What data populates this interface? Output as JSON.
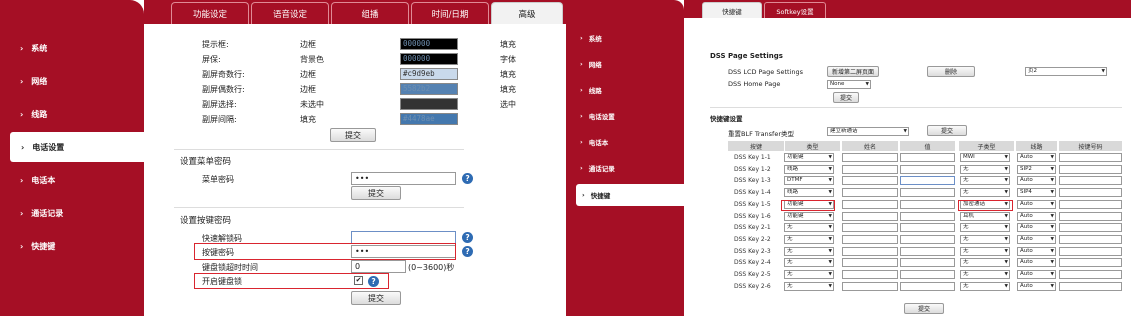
{
  "left": {
    "nav": [
      {
        "label": "系统",
        "active": false
      },
      {
        "label": "网络",
        "active": false
      },
      {
        "label": "线路",
        "active": false
      },
      {
        "label": "电话设置",
        "active": true
      },
      {
        "label": "电话本",
        "active": false
      },
      {
        "label": "通话记录",
        "active": false
      },
      {
        "label": "快捷键",
        "active": false
      }
    ],
    "tabs": [
      "功能设定",
      "语音设定",
      "组播",
      "时间/日期",
      "高级"
    ],
    "active_tab": 4,
    "color_rows": [
      {
        "label": "提示框:",
        "value": "边框",
        "color": "000000",
        "hex": "#000000",
        "style": "填充"
      },
      {
        "label": "屏保:",
        "value": "背景色",
        "color": "000000",
        "hex": "#000000",
        "style": "字体"
      },
      {
        "label": "副屏奇数行:",
        "value": "边框",
        "color": "#c9d9eb",
        "hex": "#c9d9eb",
        "style": "填充"
      },
      {
        "label": "副屏偶数行:",
        "value": "边框",
        "color": "5582b2",
        "hex": "#5582b2",
        "style": "填充"
      },
      {
        "label": "副屏选择:",
        "value": "未选中",
        "color": "",
        "hex": "#333333",
        "style": "选中"
      },
      {
        "label": "副屏间隔:",
        "value": "填充",
        "color": "#4478ae",
        "hex": "#4478ae",
        "style": ""
      }
    ],
    "submit_label": "提交",
    "menu_pw_section": "设置菜单密码",
    "menu_pw_label": "菜单密码",
    "menu_pw_value": "•••",
    "key_pw_section": "设置按键密码",
    "quick_unlock_label": "快速解锁码",
    "quick_unlock_value": "",
    "key_pw_label": "按键密码",
    "key_pw_value": "•••",
    "lock_timeout_label": "键盘锁超时时间",
    "lock_timeout_value": "0",
    "lock_timeout_range": "(0~3600)秒",
    "enable_lock_label": "开启键盘锁",
    "help_glyph": "?"
  },
  "right": {
    "nav": [
      {
        "label": "系统",
        "active": false
      },
      {
        "label": "网络",
        "active": false
      },
      {
        "label": "线路",
        "active": false
      },
      {
        "label": "电话设置",
        "active": false
      },
      {
        "label": "电话本",
        "active": false
      },
      {
        "label": "通话记录",
        "active": false
      },
      {
        "label": "快捷键",
        "active": true
      }
    ],
    "tabs": [
      "快捷键",
      "Softkey设置"
    ],
    "active_tab": 0,
    "dss_page_title": "DSS Page Settings",
    "lcd_label": "DSS LCD Page Settings",
    "add_page_btn": "新增第二屏页面",
    "delete_btn": "删除",
    "page_select": "页2",
    "home_label": "DSS Home Page",
    "home_value": "None",
    "submit_label": "提交",
    "shortcut_title": "快捷键设置",
    "blf_label": "重置BLF Transfer类型",
    "blf_value": "建立新通话",
    "columns": [
      "按键",
      "类型",
      "姓名",
      "值",
      "子类型",
      "线路",
      "按键号码"
    ],
    "keys": [
      {
        "key": "DSS Key 1-1",
        "type": "功能键",
        "subtype": "MWI",
        "line": "Auto"
      },
      {
        "key": "DSS Key 1-2",
        "type": "线路",
        "subtype": "无",
        "line": "SIP2"
      },
      {
        "key": "DSS Key 1-3",
        "type": "DTMF",
        "subtype": "无",
        "line": "Auto"
      },
      {
        "key": "DSS Key 1-4",
        "type": "线路",
        "subtype": "无",
        "line": "SIP4"
      },
      {
        "key": "DSS Key 1-5",
        "type": "功能键",
        "subtype": "加密通话",
        "line": "Auto"
      },
      {
        "key": "DSS Key 1-6",
        "type": "功能键",
        "subtype": "耳机",
        "line": "Auto"
      },
      {
        "key": "DSS Key 2-1",
        "type": "无",
        "subtype": "无",
        "line": "Auto"
      },
      {
        "key": "DSS Key 2-2",
        "type": "无",
        "subtype": "无",
        "line": "Auto"
      },
      {
        "key": "DSS Key 2-3",
        "type": "无",
        "subtype": "无",
        "line": "Auto"
      },
      {
        "key": "DSS Key 2-4",
        "type": "无",
        "subtype": "无",
        "line": "Auto"
      },
      {
        "key": "DSS Key 2-5",
        "type": "无",
        "subtype": "无",
        "line": "Auto"
      },
      {
        "key": "DSS Key 2-6",
        "type": "无",
        "subtype": "无",
        "line": "Auto"
      }
    ]
  }
}
